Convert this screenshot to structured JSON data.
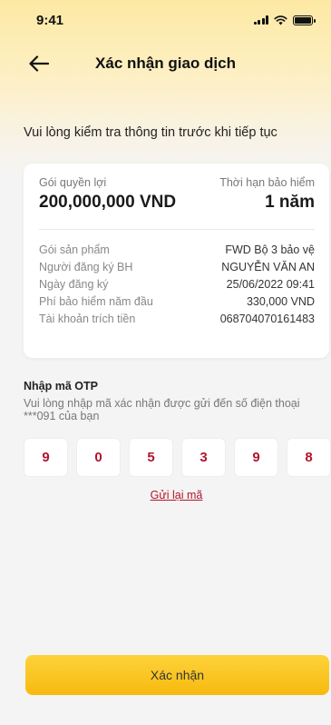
{
  "status_bar": {
    "time": "9:41",
    "icons": [
      "signal-icon",
      "wifi-icon",
      "battery-icon"
    ]
  },
  "header": {
    "title": "Xác nhận giao dịch",
    "back_icon": "arrow-left-icon"
  },
  "intro_text": "Vui lòng kiểm tra thông tin trước khi tiếp tục",
  "summary": {
    "benefit_label": "Gói quyền lợi",
    "benefit_value": "200,000,000 VND",
    "term_label": "Thời hạn bảo hiểm",
    "term_value": "1 năm"
  },
  "details": [
    {
      "label": "Gói sản phẩm",
      "value": "FWD Bộ 3 bảo vệ"
    },
    {
      "label": "Người đăng ký BH",
      "value": "NGUYỄN VĂN AN"
    },
    {
      "label": "Ngày đăng ký",
      "value": "25/06/2022 09:41"
    },
    {
      "label": "Phí bảo hiểm năm đầu",
      "value": "330,000 VND"
    },
    {
      "label": "Tài khoản trích tiền",
      "value": "068704070161483"
    }
  ],
  "otp": {
    "title": "Nhập mã OTP",
    "description": "Vui lòng nhập mã xác nhận được gửi đến số điện thoại ***091 của bạn",
    "digits": [
      "9",
      "0",
      "5",
      "3",
      "9",
      "8"
    ],
    "resend_label": "Gửi lại mã"
  },
  "confirm_label": "Xác nhận",
  "colors": {
    "accent": "#b3142c",
    "button": "#f7b90f",
    "header_gradient": "#fde9a4"
  }
}
